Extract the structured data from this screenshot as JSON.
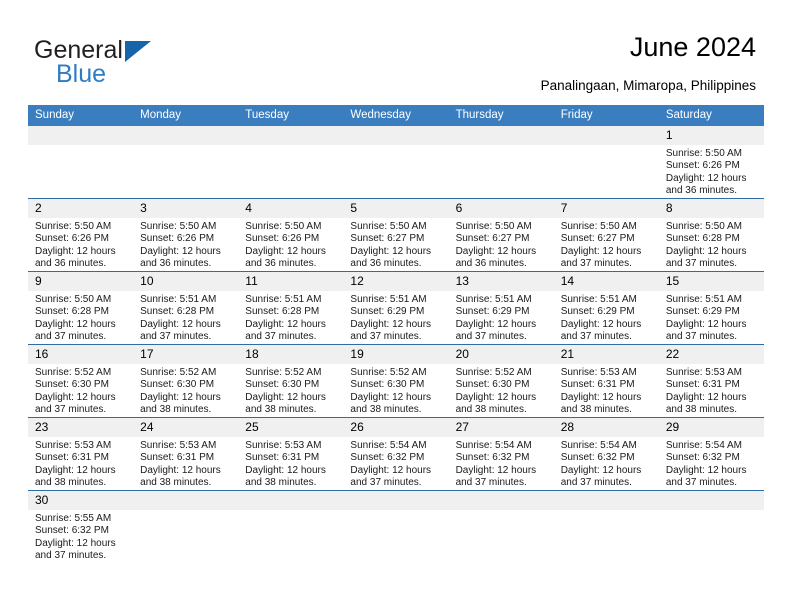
{
  "brand": {
    "name_part1": "General",
    "name_part2": "Blue",
    "accent_color": "#2e7dc4",
    "logo_triangle_color": "#1665a8"
  },
  "header": {
    "title": "June 2024",
    "subtitle": "Panalingaan, Mimaropa, Philippines"
  },
  "calendar": {
    "header_bg_color": "#3b7ec0",
    "daynum_bg_color": "#f0f0f0",
    "row_line_color": "#2e6da4",
    "weekdays": [
      "Sunday",
      "Monday",
      "Tuesday",
      "Wednesday",
      "Thursday",
      "Friday",
      "Saturday"
    ],
    "weeks": [
      [
        {
          "day": "",
          "empty": true
        },
        {
          "day": "",
          "empty": true
        },
        {
          "day": "",
          "empty": true
        },
        {
          "day": "",
          "empty": true
        },
        {
          "day": "",
          "empty": true
        },
        {
          "day": "",
          "empty": true
        },
        {
          "day": "1",
          "sunrise": "Sunrise: 5:50 AM",
          "sunset": "Sunset: 6:26 PM",
          "daylight1": "Daylight: 12 hours",
          "daylight2": "and 36 minutes."
        }
      ],
      [
        {
          "day": "2",
          "sunrise": "Sunrise: 5:50 AM",
          "sunset": "Sunset: 6:26 PM",
          "daylight1": "Daylight: 12 hours",
          "daylight2": "and 36 minutes."
        },
        {
          "day": "3",
          "sunrise": "Sunrise: 5:50 AM",
          "sunset": "Sunset: 6:26 PM",
          "daylight1": "Daylight: 12 hours",
          "daylight2": "and 36 minutes."
        },
        {
          "day": "4",
          "sunrise": "Sunrise: 5:50 AM",
          "sunset": "Sunset: 6:26 PM",
          "daylight1": "Daylight: 12 hours",
          "daylight2": "and 36 minutes."
        },
        {
          "day": "5",
          "sunrise": "Sunrise: 5:50 AM",
          "sunset": "Sunset: 6:27 PM",
          "daylight1": "Daylight: 12 hours",
          "daylight2": "and 36 minutes."
        },
        {
          "day": "6",
          "sunrise": "Sunrise: 5:50 AM",
          "sunset": "Sunset: 6:27 PM",
          "daylight1": "Daylight: 12 hours",
          "daylight2": "and 36 minutes."
        },
        {
          "day": "7",
          "sunrise": "Sunrise: 5:50 AM",
          "sunset": "Sunset: 6:27 PM",
          "daylight1": "Daylight: 12 hours",
          "daylight2": "and 37 minutes."
        },
        {
          "day": "8",
          "sunrise": "Sunrise: 5:50 AM",
          "sunset": "Sunset: 6:28 PM",
          "daylight1": "Daylight: 12 hours",
          "daylight2": "and 37 minutes."
        }
      ],
      [
        {
          "day": "9",
          "sunrise": "Sunrise: 5:50 AM",
          "sunset": "Sunset: 6:28 PM",
          "daylight1": "Daylight: 12 hours",
          "daylight2": "and 37 minutes."
        },
        {
          "day": "10",
          "sunrise": "Sunrise: 5:51 AM",
          "sunset": "Sunset: 6:28 PM",
          "daylight1": "Daylight: 12 hours",
          "daylight2": "and 37 minutes."
        },
        {
          "day": "11",
          "sunrise": "Sunrise: 5:51 AM",
          "sunset": "Sunset: 6:28 PM",
          "daylight1": "Daylight: 12 hours",
          "daylight2": "and 37 minutes."
        },
        {
          "day": "12",
          "sunrise": "Sunrise: 5:51 AM",
          "sunset": "Sunset: 6:29 PM",
          "daylight1": "Daylight: 12 hours",
          "daylight2": "and 37 minutes."
        },
        {
          "day": "13",
          "sunrise": "Sunrise: 5:51 AM",
          "sunset": "Sunset: 6:29 PM",
          "daylight1": "Daylight: 12 hours",
          "daylight2": "and 37 minutes."
        },
        {
          "day": "14",
          "sunrise": "Sunrise: 5:51 AM",
          "sunset": "Sunset: 6:29 PM",
          "daylight1": "Daylight: 12 hours",
          "daylight2": "and 37 minutes."
        },
        {
          "day": "15",
          "sunrise": "Sunrise: 5:51 AM",
          "sunset": "Sunset: 6:29 PM",
          "daylight1": "Daylight: 12 hours",
          "daylight2": "and 37 minutes."
        }
      ],
      [
        {
          "day": "16",
          "sunrise": "Sunrise: 5:52 AM",
          "sunset": "Sunset: 6:30 PM",
          "daylight1": "Daylight: 12 hours",
          "daylight2": "and 37 minutes."
        },
        {
          "day": "17",
          "sunrise": "Sunrise: 5:52 AM",
          "sunset": "Sunset: 6:30 PM",
          "daylight1": "Daylight: 12 hours",
          "daylight2": "and 38 minutes."
        },
        {
          "day": "18",
          "sunrise": "Sunrise: 5:52 AM",
          "sunset": "Sunset: 6:30 PM",
          "daylight1": "Daylight: 12 hours",
          "daylight2": "and 38 minutes."
        },
        {
          "day": "19",
          "sunrise": "Sunrise: 5:52 AM",
          "sunset": "Sunset: 6:30 PM",
          "daylight1": "Daylight: 12 hours",
          "daylight2": "and 38 minutes."
        },
        {
          "day": "20",
          "sunrise": "Sunrise: 5:52 AM",
          "sunset": "Sunset: 6:30 PM",
          "daylight1": "Daylight: 12 hours",
          "daylight2": "and 38 minutes."
        },
        {
          "day": "21",
          "sunrise": "Sunrise: 5:53 AM",
          "sunset": "Sunset: 6:31 PM",
          "daylight1": "Daylight: 12 hours",
          "daylight2": "and 38 minutes."
        },
        {
          "day": "22",
          "sunrise": "Sunrise: 5:53 AM",
          "sunset": "Sunset: 6:31 PM",
          "daylight1": "Daylight: 12 hours",
          "daylight2": "and 38 minutes."
        }
      ],
      [
        {
          "day": "23",
          "sunrise": "Sunrise: 5:53 AM",
          "sunset": "Sunset: 6:31 PM",
          "daylight1": "Daylight: 12 hours",
          "daylight2": "and 38 minutes."
        },
        {
          "day": "24",
          "sunrise": "Sunrise: 5:53 AM",
          "sunset": "Sunset: 6:31 PM",
          "daylight1": "Daylight: 12 hours",
          "daylight2": "and 38 minutes."
        },
        {
          "day": "25",
          "sunrise": "Sunrise: 5:53 AM",
          "sunset": "Sunset: 6:31 PM",
          "daylight1": "Daylight: 12 hours",
          "daylight2": "and 38 minutes."
        },
        {
          "day": "26",
          "sunrise": "Sunrise: 5:54 AM",
          "sunset": "Sunset: 6:32 PM",
          "daylight1": "Daylight: 12 hours",
          "daylight2": "and 37 minutes."
        },
        {
          "day": "27",
          "sunrise": "Sunrise: 5:54 AM",
          "sunset": "Sunset: 6:32 PM",
          "daylight1": "Daylight: 12 hours",
          "daylight2": "and 37 minutes."
        },
        {
          "day": "28",
          "sunrise": "Sunrise: 5:54 AM",
          "sunset": "Sunset: 6:32 PM",
          "daylight1": "Daylight: 12 hours",
          "daylight2": "and 37 minutes."
        },
        {
          "day": "29",
          "sunrise": "Sunrise: 5:54 AM",
          "sunset": "Sunset: 6:32 PM",
          "daylight1": "Daylight: 12 hours",
          "daylight2": "and 37 minutes."
        }
      ],
      [
        {
          "day": "30",
          "sunrise": "Sunrise: 5:55 AM",
          "sunset": "Sunset: 6:32 PM",
          "daylight1": "Daylight: 12 hours",
          "daylight2": "and 37 minutes."
        },
        {
          "day": "",
          "empty": true
        },
        {
          "day": "",
          "empty": true
        },
        {
          "day": "",
          "empty": true
        },
        {
          "day": "",
          "empty": true
        },
        {
          "day": "",
          "empty": true
        },
        {
          "day": "",
          "empty": true
        }
      ]
    ]
  }
}
